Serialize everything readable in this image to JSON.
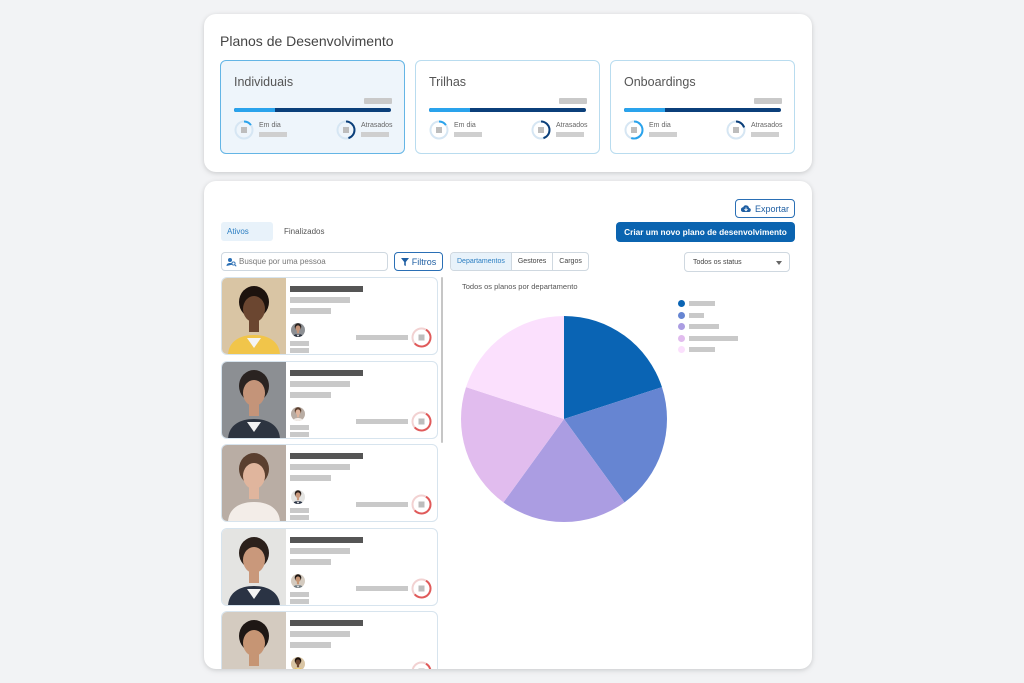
{
  "top": {
    "title": "Planos de Desenvolvimento",
    "plans": [
      {
        "name": "Individuais",
        "active": true,
        "progress": 0.26,
        "on_time_label": "Em dia",
        "late_label": "Atrasados",
        "on_time_level": 0.15,
        "late_level": 0.45
      },
      {
        "name": "Trilhas",
        "active": false,
        "progress": 0.26,
        "on_time_label": "Em dia",
        "late_label": "Atrasados",
        "on_time_level": 0.15,
        "late_level": 0.45
      },
      {
        "name": "Onboardings",
        "active": false,
        "progress": 0.26,
        "on_time_label": "Em dia",
        "late_label": "Atrasados",
        "on_time_level": 0.55,
        "late_level": 0.2
      }
    ]
  },
  "main": {
    "export_label": "Exportar",
    "tabs": [
      {
        "label": "Ativos",
        "active": true
      },
      {
        "label": "Finalizados",
        "active": false
      }
    ],
    "create_label": "Criar um novo plano de desenvolvimento",
    "search_placeholder": "Busque por uma pessoa",
    "filter_label": "Filtros",
    "segments": [
      "Departamentos",
      "Gestores",
      "Cargos"
    ],
    "status_select": "Todos os status",
    "people_count": 5
  },
  "chart_data": {
    "type": "pie",
    "title": "Todos os planos por departamento",
    "values": [
      0.2,
      0.2,
      0.2,
      0.2,
      0.2
    ],
    "colors": [
      "#0a64b4",
      "#6685d2",
      "#ab9de2",
      "#e1bcee",
      "#fbe0fd"
    ]
  },
  "colors": {
    "primary": "#0b64b0",
    "accent": "#2aa3ec",
    "ring_late": "#e05a5a"
  }
}
